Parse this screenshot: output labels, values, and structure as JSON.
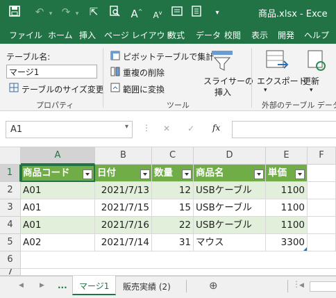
{
  "window": {
    "title": "商品.xlsx  -  Exce"
  },
  "ribbon_tabs": [
    "ファイル",
    "ホーム",
    "挿入",
    "ページ レイアウト",
    "数式",
    "データ",
    "校閲",
    "表示",
    "開発",
    "ヘルプ"
  ],
  "ribbon": {
    "table_name_label": "テーブル名:",
    "table_name_value": "マージ1",
    "resize_table": "テーブルのサイズ変更",
    "properties_group": "プロパティ",
    "pivot": "ピボットテーブルで集計",
    "remove_duplicates": "重複の削除",
    "convert_range": "範囲に変換",
    "tools_group": "ツール",
    "slicer_line1": "スライサーの",
    "slicer_line2": "挿入",
    "export": "エクスポート",
    "refresh": "更新",
    "external_group": "外部のテーブル データ"
  },
  "formula_bar": {
    "name_box": "A1",
    "fx": "fx",
    "cancel": "✕",
    "enter": "✓"
  },
  "grid": {
    "columns": [
      "A",
      "B",
      "C",
      "D",
      "E",
      "F"
    ],
    "rows": [
      "1",
      "2",
      "3",
      "4",
      "5",
      "6",
      "7"
    ],
    "headers": [
      "商品コード",
      "日付",
      "数量",
      "商品名",
      "単価"
    ],
    "data": [
      [
        "A01",
        "2021/7/13",
        "12",
        "USBケーブル",
        "1100"
      ],
      [
        "A01",
        "2021/7/15",
        "15",
        "USBケーブル",
        "1100"
      ],
      [
        "A01",
        "2021/7/16",
        "22",
        "USBケーブル",
        "1100"
      ],
      [
        "A02",
        "2021/7/14",
        "31",
        "マウス",
        "3300"
      ]
    ]
  },
  "sheets": {
    "ellipsis": "...",
    "tabs": [
      "マージ1",
      "販売実績 (2)"
    ],
    "active": "マージ1",
    "add": "⊕"
  },
  "colors": {
    "excel_green": "#217346",
    "table_header": "#70ad47",
    "band": "#e2efda"
  }
}
